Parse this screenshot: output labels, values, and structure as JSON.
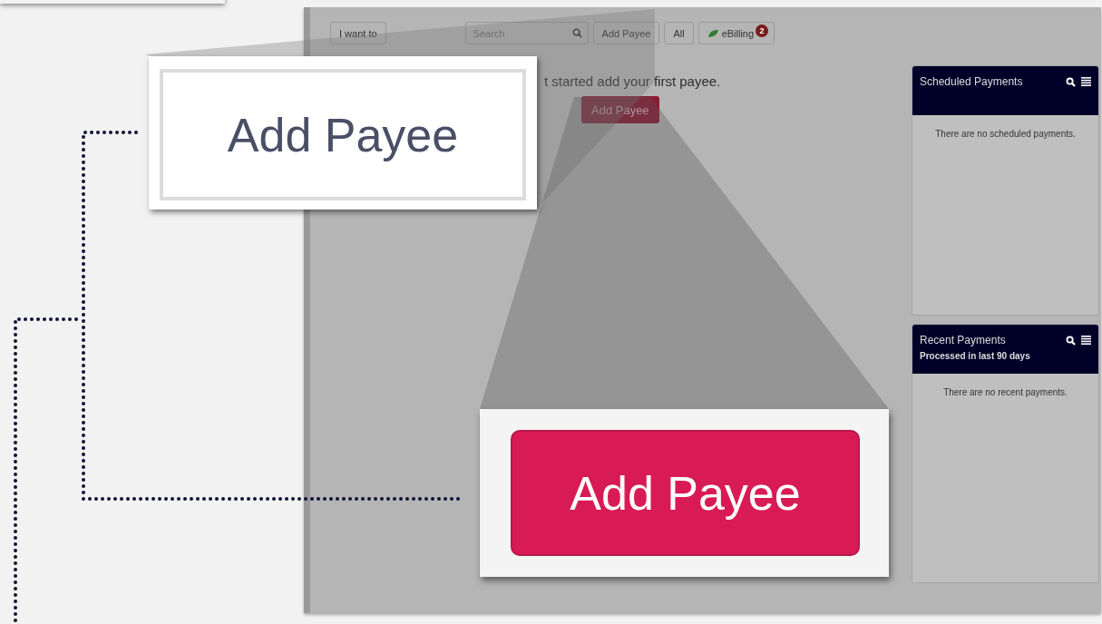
{
  "toolbar": {
    "menu_button": "I want to",
    "search": {
      "placeholder": "Search"
    },
    "buttons": [
      "Add Payee",
      "All"
    ],
    "ebilling": {
      "label": "eBilling",
      "badge": "2"
    }
  },
  "main": {
    "message": "t started add your first payee.",
    "button": "Add Payee"
  },
  "panels": [
    {
      "title": "Scheduled Payments",
      "empty_text": "There are no scheduled payments."
    },
    {
      "title": "Recent Payments",
      "subtitle": "Processed in last 90 days",
      "empty_text": "There are no recent payments."
    }
  ],
  "zoom_toolbar_button": {
    "label": "Add Payee"
  },
  "zoom_primary_button": {
    "label": "Add Payee"
  }
}
